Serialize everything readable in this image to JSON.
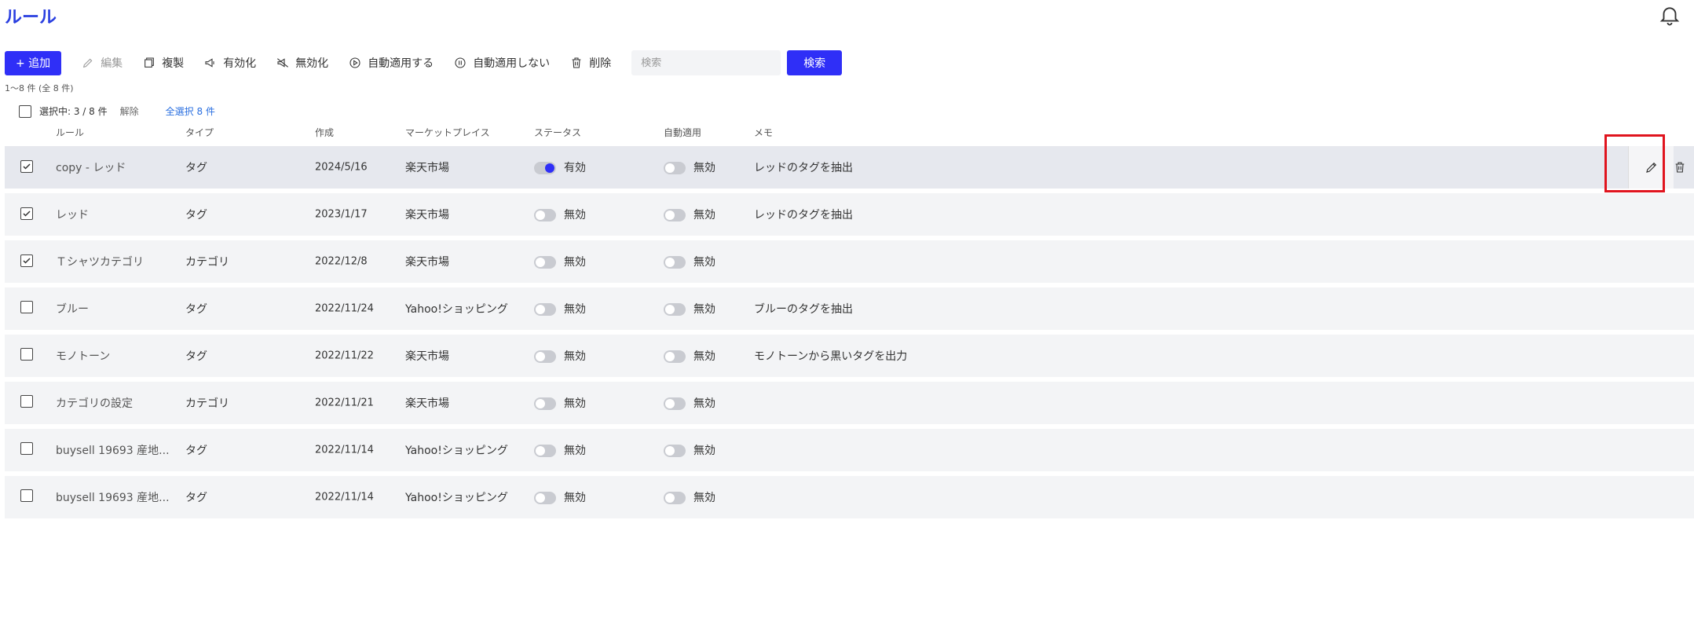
{
  "page": {
    "title": "ルール"
  },
  "toolbar": {
    "add_label": "+ 追加",
    "edit_label": "編集",
    "copy_label": "複製",
    "enable_label": "有効化",
    "disable_label": "無効化",
    "auto_apply_label": "自動適用する",
    "no_auto_apply_label": "自動適用しない",
    "delete_label": "削除",
    "search_placeholder": "検索",
    "search_button": "検索"
  },
  "count_text": "1～8 件 (全 8 件)",
  "selection": {
    "selected_text": "選択中: 3 / 8 件",
    "unselect_label": "解除",
    "select_all_label": "全選択 8 件"
  },
  "columns": {
    "rule": "ルール",
    "type": "タイプ",
    "created": "作成",
    "marketplace": "マーケットプレイス",
    "status": "ステータス",
    "auto_apply": "自動適用",
    "memo": "メモ"
  },
  "rows": [
    {
      "checked": true,
      "rule": "copy - レッド",
      "type": "タグ",
      "created": "2024/5/16",
      "marketplace": "楽天市場",
      "status": "有効",
      "status_on": true,
      "auto": "無効",
      "memo": "レッドのタグを抽出"
    },
    {
      "checked": true,
      "rule": "レッド",
      "type": "タグ",
      "created": "2023/1/17",
      "marketplace": "楽天市場",
      "status": "無効",
      "status_on": false,
      "auto": "無効",
      "memo": "レッドのタグを抽出"
    },
    {
      "checked": true,
      "rule": "Ｔシャツカテゴリ",
      "type": "カテゴリ",
      "created": "2022/12/8",
      "marketplace": "楽天市場",
      "status": "無効",
      "status_on": false,
      "auto": "無効",
      "memo": ""
    },
    {
      "checked": false,
      "rule": "ブルー",
      "type": "タグ",
      "created": "2022/11/24",
      "marketplace": "Yahoo!ショッピング",
      "status": "無効",
      "status_on": false,
      "auto": "無効",
      "memo": "ブルーのタグを抽出"
    },
    {
      "checked": false,
      "rule": "モノトーン",
      "type": "タグ",
      "created": "2022/11/22",
      "marketplace": "楽天市場",
      "status": "無効",
      "status_on": false,
      "auto": "無効",
      "memo": "モノトーンから黒いタグを出力"
    },
    {
      "checked": false,
      "rule": "カテゴリの設定",
      "type": "カテゴリ",
      "created": "2022/11/21",
      "marketplace": "楽天市場",
      "status": "無効",
      "status_on": false,
      "auto": "無効",
      "memo": ""
    },
    {
      "checked": false,
      "rule": "buysell 19693 産地...",
      "type": "タグ",
      "created": "2022/11/14",
      "marketplace": "Yahoo!ショッピング",
      "status": "無効",
      "status_on": false,
      "auto": "無効",
      "memo": ""
    },
    {
      "checked": false,
      "rule": "buysell 19693 産地...",
      "type": "タグ",
      "created": "2022/11/14",
      "marketplace": "Yahoo!ショッピング",
      "status": "無効",
      "status_on": false,
      "auto": "無効",
      "memo": ""
    }
  ]
}
